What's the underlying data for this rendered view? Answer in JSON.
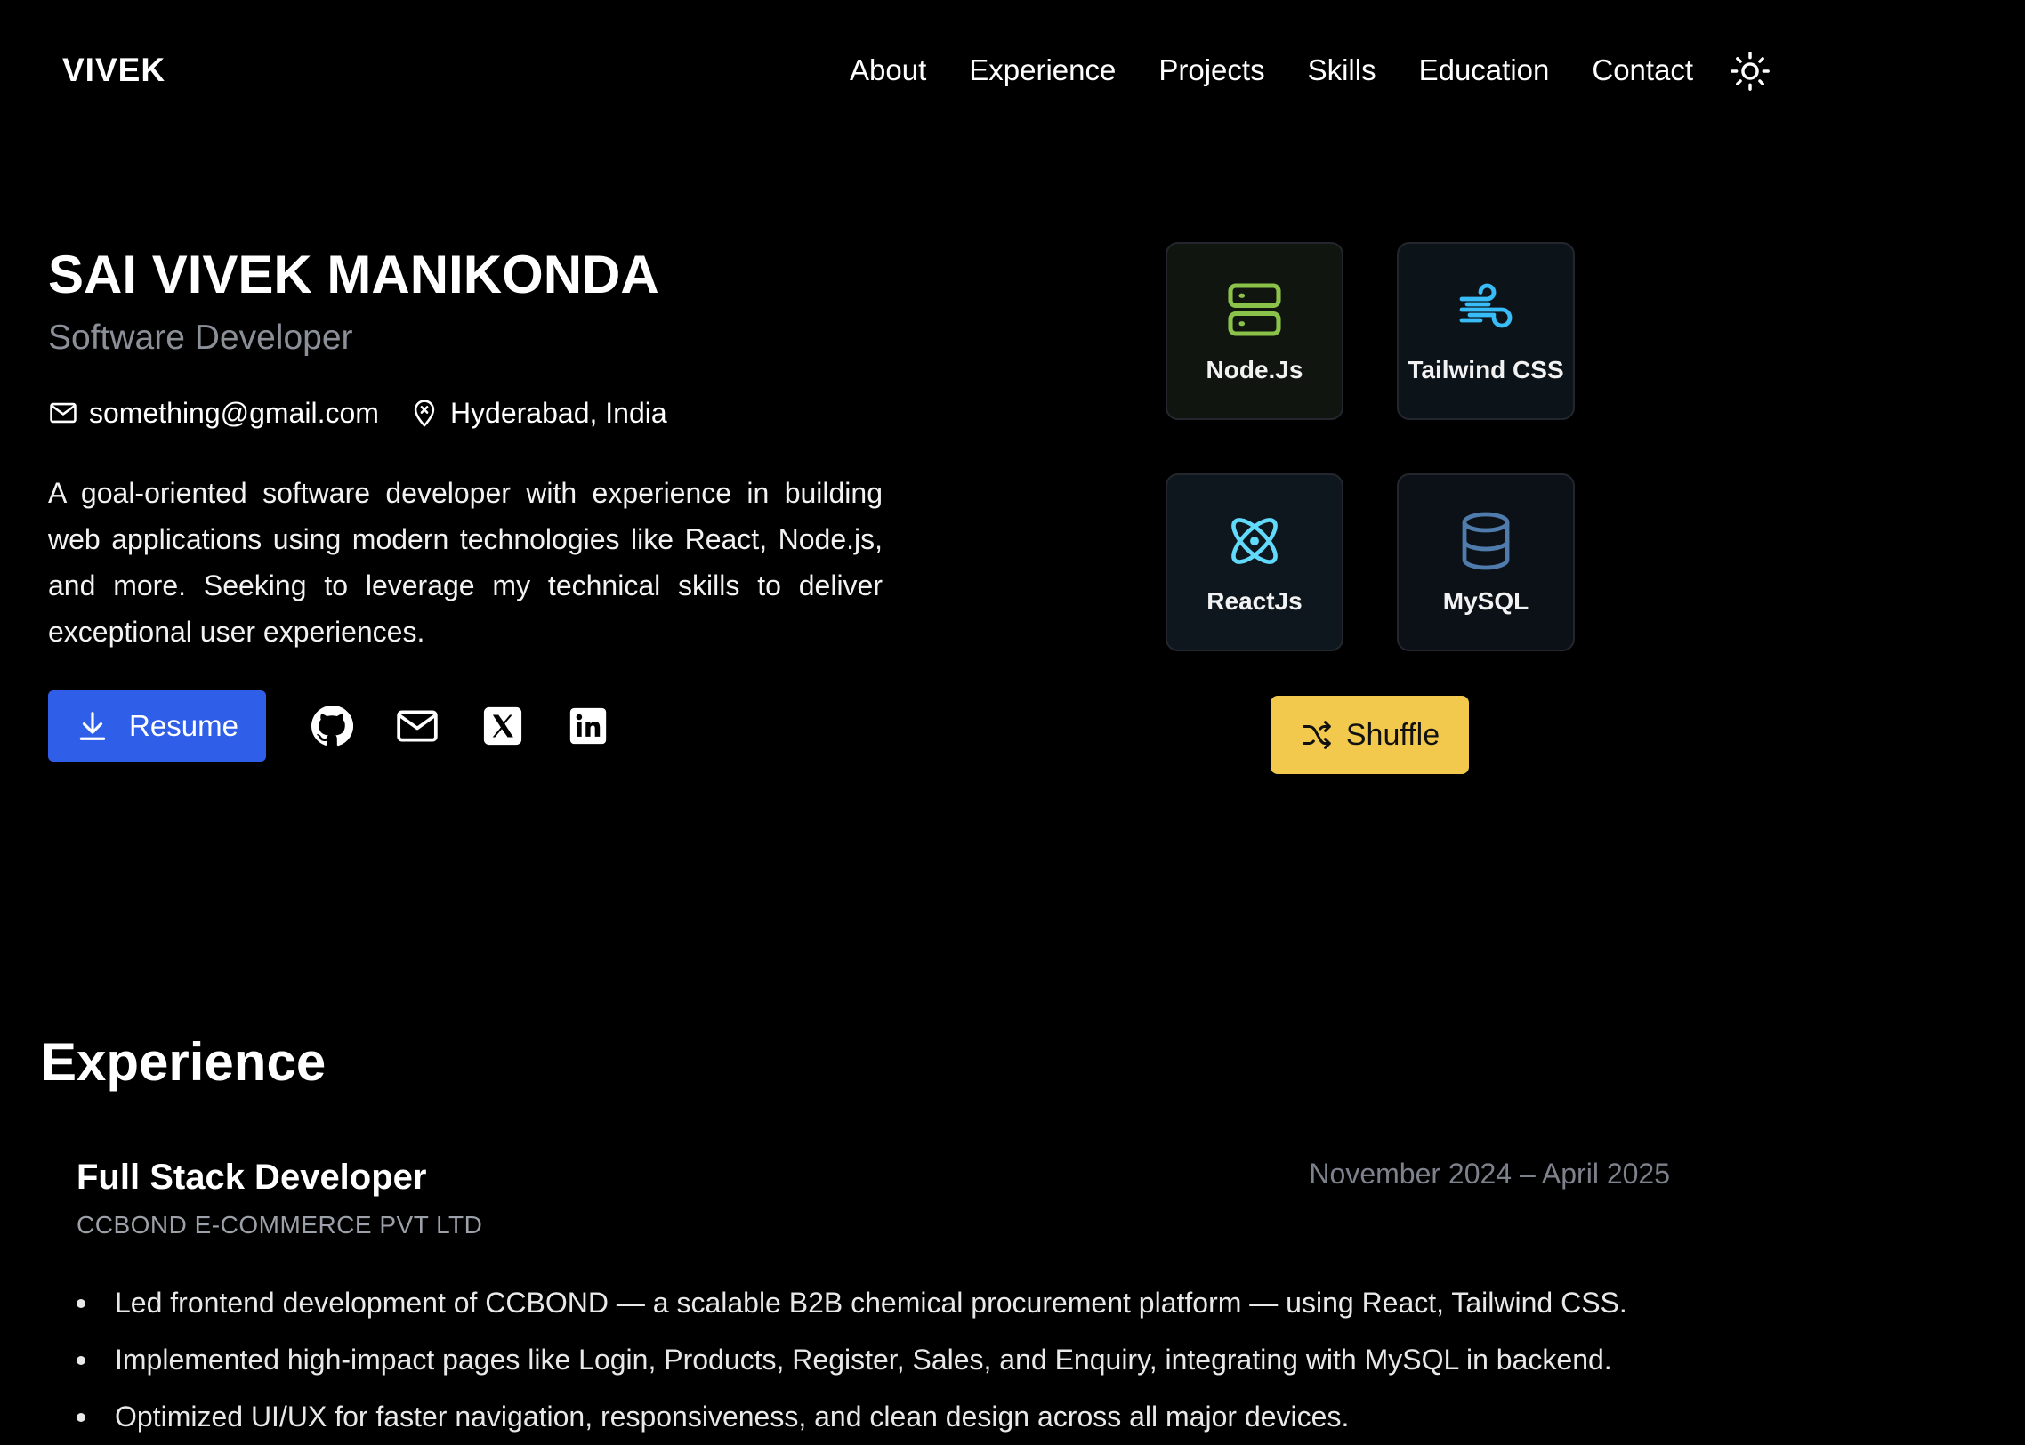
{
  "nav": {
    "brand": "VIVEK",
    "links": [
      "About",
      "Experience",
      "Projects",
      "Skills",
      "Education",
      "Contact"
    ],
    "theme_icon": "sun-icon"
  },
  "hero": {
    "name": "SAI VIVEK MANIKONDA",
    "role": "Software Developer",
    "email": "something@gmail.com",
    "location": "Hyderabad, India",
    "bio": "A goal-oriented software developer with experience in building web applications using modern technologies like React, Node.js, and more. Seeking to leverage my technical skills to deliver exceptional user experiences.",
    "resume_label": "Resume",
    "socials": [
      "github-icon",
      "mail-icon",
      "x-icon",
      "linkedin-icon"
    ],
    "accent_color": "#2f5fe8"
  },
  "skills": {
    "cards": [
      {
        "label": "Node.Js",
        "icon": "server-icon",
        "color": "#8bc34a"
      },
      {
        "label": "Tailwind CSS",
        "icon": "wind-icon",
        "color": "#38bdf8"
      },
      {
        "label": "ReactJs",
        "icon": "atom-icon",
        "color": "#61dafb"
      },
      {
        "label": "MySQL",
        "icon": "database-icon",
        "color": "#4f7cad"
      }
    ],
    "shuffle_label": "Shuffle",
    "shuffle_color": "#f2c94c"
  },
  "experience": {
    "title": "Experience",
    "jobs": [
      {
        "title": "Full Stack Developer",
        "company": "CCBOND E-COMMERCE PVT LTD",
        "date": "November 2024 – April 2025",
        "bullets": [
          "Led frontend development of CCBOND — a scalable B2B chemical procurement platform — using React, Tailwind CSS.",
          "Implemented high-impact pages like Login, Products, Register, Sales, and Enquiry, integrating with MySQL in backend.",
          "Optimized UI/UX for faster navigation, responsiveness, and clean design across all major devices."
        ]
      }
    ]
  }
}
